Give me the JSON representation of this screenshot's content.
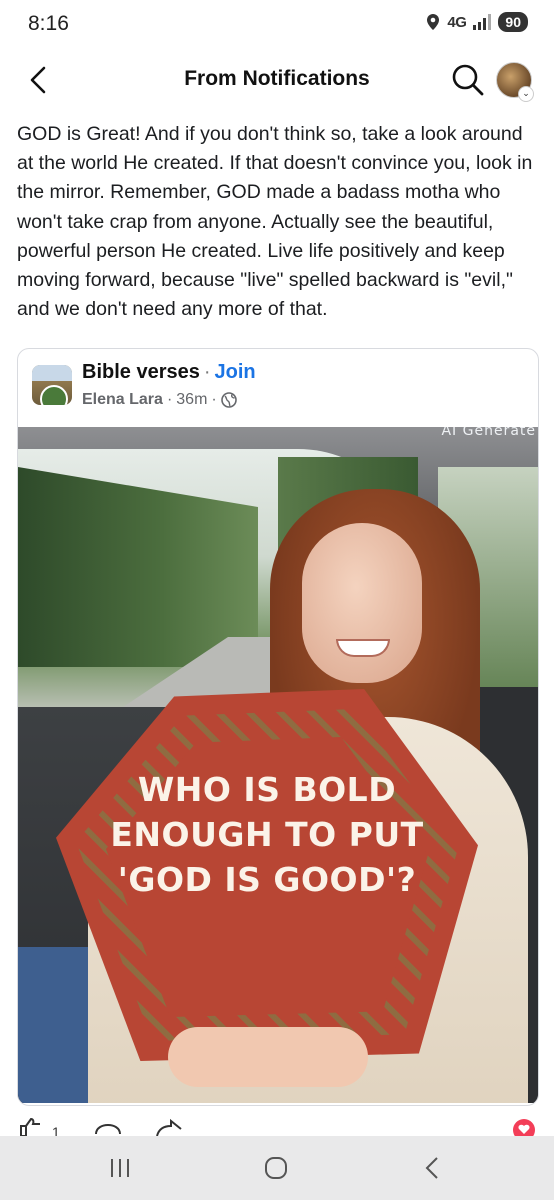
{
  "status_bar": {
    "time": "8:16",
    "network": "4G",
    "battery": "90"
  },
  "header": {
    "title": "From Notifications"
  },
  "post": {
    "text": "GOD is Great! And if you don't think so, take a look around at the world He created. If that doesn't convince you, look in the mirror. Remember, GOD made a badass motha who won't take crap from anyone. Actually see the beautiful, powerful person He created. Live life positively and keep moving forward, because \"live\" spelled backward is \"evil,\" and we don't need any more of that."
  },
  "shared_post": {
    "group_name": "Bible verses",
    "separator": "·",
    "join_label": "Join",
    "author": "Elena Lara",
    "time": "36m",
    "ai_label": "AI Generate",
    "pillow_text": "WHO IS BOLD ENOUGH TO PUT 'GOD IS GOOD'?"
  },
  "reactions": {
    "like_count": "1"
  },
  "icons": [
    "back-arrow-icon",
    "search-icon",
    "globe-icon",
    "like-icon",
    "comment-icon",
    "share-icon",
    "love-icon",
    "recent-apps-icon",
    "home-icon",
    "system-back-icon"
  ]
}
